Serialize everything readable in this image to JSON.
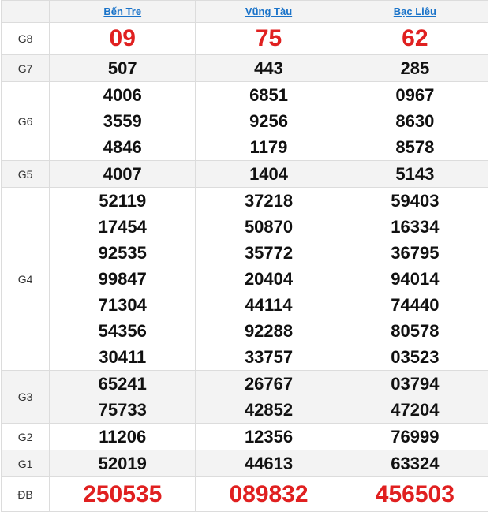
{
  "provinces": [
    "Bến Tre",
    "Vũng Tàu",
    "Bạc Liêu"
  ],
  "prizes": [
    {
      "label": "G8",
      "values": [
        [
          "09"
        ],
        [
          "75"
        ],
        [
          "62"
        ]
      ]
    },
    {
      "label": "G7",
      "values": [
        [
          "507"
        ],
        [
          "443"
        ],
        [
          "285"
        ]
      ]
    },
    {
      "label": "G6",
      "values": [
        [
          "4006",
          "3559",
          "4846"
        ],
        [
          "6851",
          "9256",
          "1179"
        ],
        [
          "0967",
          "8630",
          "8578"
        ]
      ]
    },
    {
      "label": "G5",
      "values": [
        [
          "4007"
        ],
        [
          "1404"
        ],
        [
          "5143"
        ]
      ]
    },
    {
      "label": "G4",
      "values": [
        [
          "52119",
          "17454",
          "92535",
          "99847",
          "71304",
          "54356",
          "30411"
        ],
        [
          "37218",
          "50870",
          "35772",
          "20404",
          "44114",
          "92288",
          "33757"
        ],
        [
          "59403",
          "16334",
          "36795",
          "94014",
          "74440",
          "80578",
          "03523"
        ]
      ]
    },
    {
      "label": "G3",
      "values": [
        [
          "65241",
          "75733"
        ],
        [
          "26767",
          "42852"
        ],
        [
          "03794",
          "47204"
        ]
      ]
    },
    {
      "label": "G2",
      "values": [
        [
          "11206"
        ],
        [
          "12356"
        ],
        [
          "76999"
        ]
      ]
    },
    {
      "label": "G1",
      "values": [
        [
          "52019"
        ],
        [
          "44613"
        ],
        [
          "63324"
        ]
      ]
    },
    {
      "label": "ĐB",
      "values": [
        [
          "250535"
        ],
        [
          "089832"
        ],
        [
          "456503"
        ]
      ]
    }
  ],
  "colors": {
    "accent_red": "#e02020",
    "link_blue": "#1a73c9",
    "row_alt": "#f3f3f3"
  }
}
